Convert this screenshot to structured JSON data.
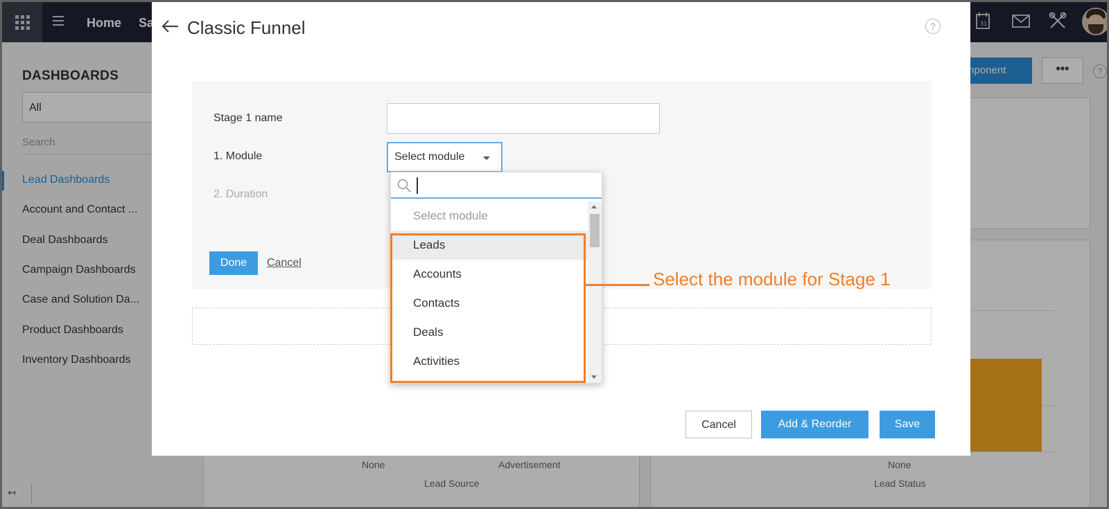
{
  "topbar": {
    "nav": [
      {
        "label": "Home"
      },
      {
        "label": "Sa"
      }
    ]
  },
  "sidebar": {
    "title": "DASHBOARDS",
    "filter_value": "All",
    "search_placeholder": "Search",
    "items": [
      {
        "label": "Lead Dashboards",
        "active": true
      },
      {
        "label": "Account and Contact ..."
      },
      {
        "label": "Deal Dashboards"
      },
      {
        "label": "Campaign Dashboards"
      },
      {
        "label": "Case and Solution Da..."
      },
      {
        "label": "Product Dashboards"
      },
      {
        "label": "Inventory Dashboards"
      }
    ]
  },
  "background": {
    "add_component_label": "mponent",
    "more_label": "•••",
    "help": "?",
    "chart_labels": {
      "none_left": "None",
      "advertisement": "Advertisement",
      "lead_source": "Lead Source",
      "none_right": "None",
      "lead_status": "Lead Status"
    }
  },
  "modal": {
    "title": "Classic Funnel",
    "help": "?",
    "stage": {
      "name_label": "Stage 1 name",
      "name_value": "",
      "module_label": "1. Module",
      "module_value": "Select module",
      "duration_label": "2. Duration"
    },
    "done_label": "Done",
    "cancel_link": "Cancel",
    "footer": {
      "cancel": "Cancel",
      "add_reorder": "Add & Reorder",
      "save": "Save"
    }
  },
  "dropdown": {
    "search_value": "",
    "options": [
      {
        "label": "Select module",
        "placeholder": true
      },
      {
        "label": "Leads",
        "highlighted": true
      },
      {
        "label": "Accounts"
      },
      {
        "label": "Contacts"
      },
      {
        "label": "Deals"
      },
      {
        "label": "Activities"
      }
    ]
  },
  "annotation": {
    "text": "Select the module for Stage 1",
    "color": "#f07f2a"
  },
  "colors": {
    "primary": "#3d9be0",
    "topbar": "#1f2436",
    "accent_link": "#2b8cd6",
    "chart_bar": "#f5a623"
  }
}
